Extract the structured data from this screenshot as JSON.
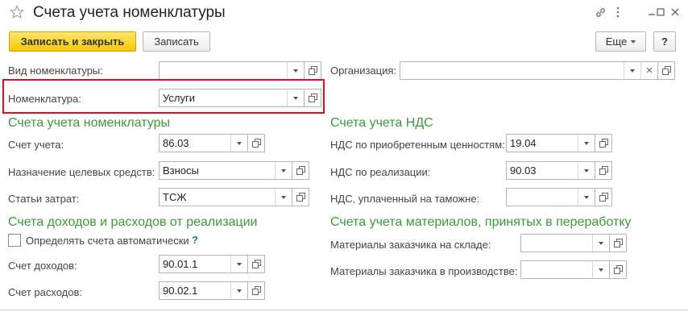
{
  "window": {
    "title": "Счета учета номенклатуры",
    "icons": [
      "star-icon",
      "link-icon",
      "more-icon",
      "maximize-icon",
      "close-icon"
    ]
  },
  "toolbar": {
    "save_close_label": "Записать и закрыть",
    "save_label": "Записать",
    "more_label": "Еще",
    "help_label": "?"
  },
  "top": {
    "vid_label": "Вид номенклатуры:",
    "vid_value": "",
    "org_label": "Организация:",
    "org_value": "",
    "nom_label": "Номенклатура:",
    "nom_value": "Услуги"
  },
  "accounts": {
    "section_title": "Счета учета номенклатуры",
    "account_label": "Счет учета:",
    "account_value": "86.03",
    "purpose_label": "Назначение целевых средств:",
    "purpose_value": "Взносы",
    "costs_label": "Статьи затрат:",
    "costs_value": "ТСЖ"
  },
  "vat": {
    "section_title": "Счета учета НДС",
    "acquired_label": "НДС по приобретенным ценностям:",
    "acquired_value": "19.04",
    "sales_label": "НДС по реализации:",
    "sales_value": "90.03",
    "customs_label": "НДС, уплаченный на таможне:",
    "customs_value": ""
  },
  "income": {
    "section_title": "Счета доходов и расходов от реализации",
    "auto_label": "Определять счета автоматически",
    "auto_checked": false,
    "auto_help": "?",
    "income_label": "Счет доходов:",
    "income_value": "90.01.1",
    "expense_label": "Счет расходов:",
    "expense_value": "90.02.1"
  },
  "materials": {
    "section_title": "Счета учета материалов, принятых в переработку",
    "warehouse_label": "Материалы заказчика на складе:",
    "warehouse_value": "",
    "production_label": "Материалы заказчика в производстве:",
    "production_value": ""
  },
  "colors": {
    "section_green": "#3a9a3a",
    "primary_yellow": "#f6c800",
    "highlight_red": "#e0101a"
  }
}
